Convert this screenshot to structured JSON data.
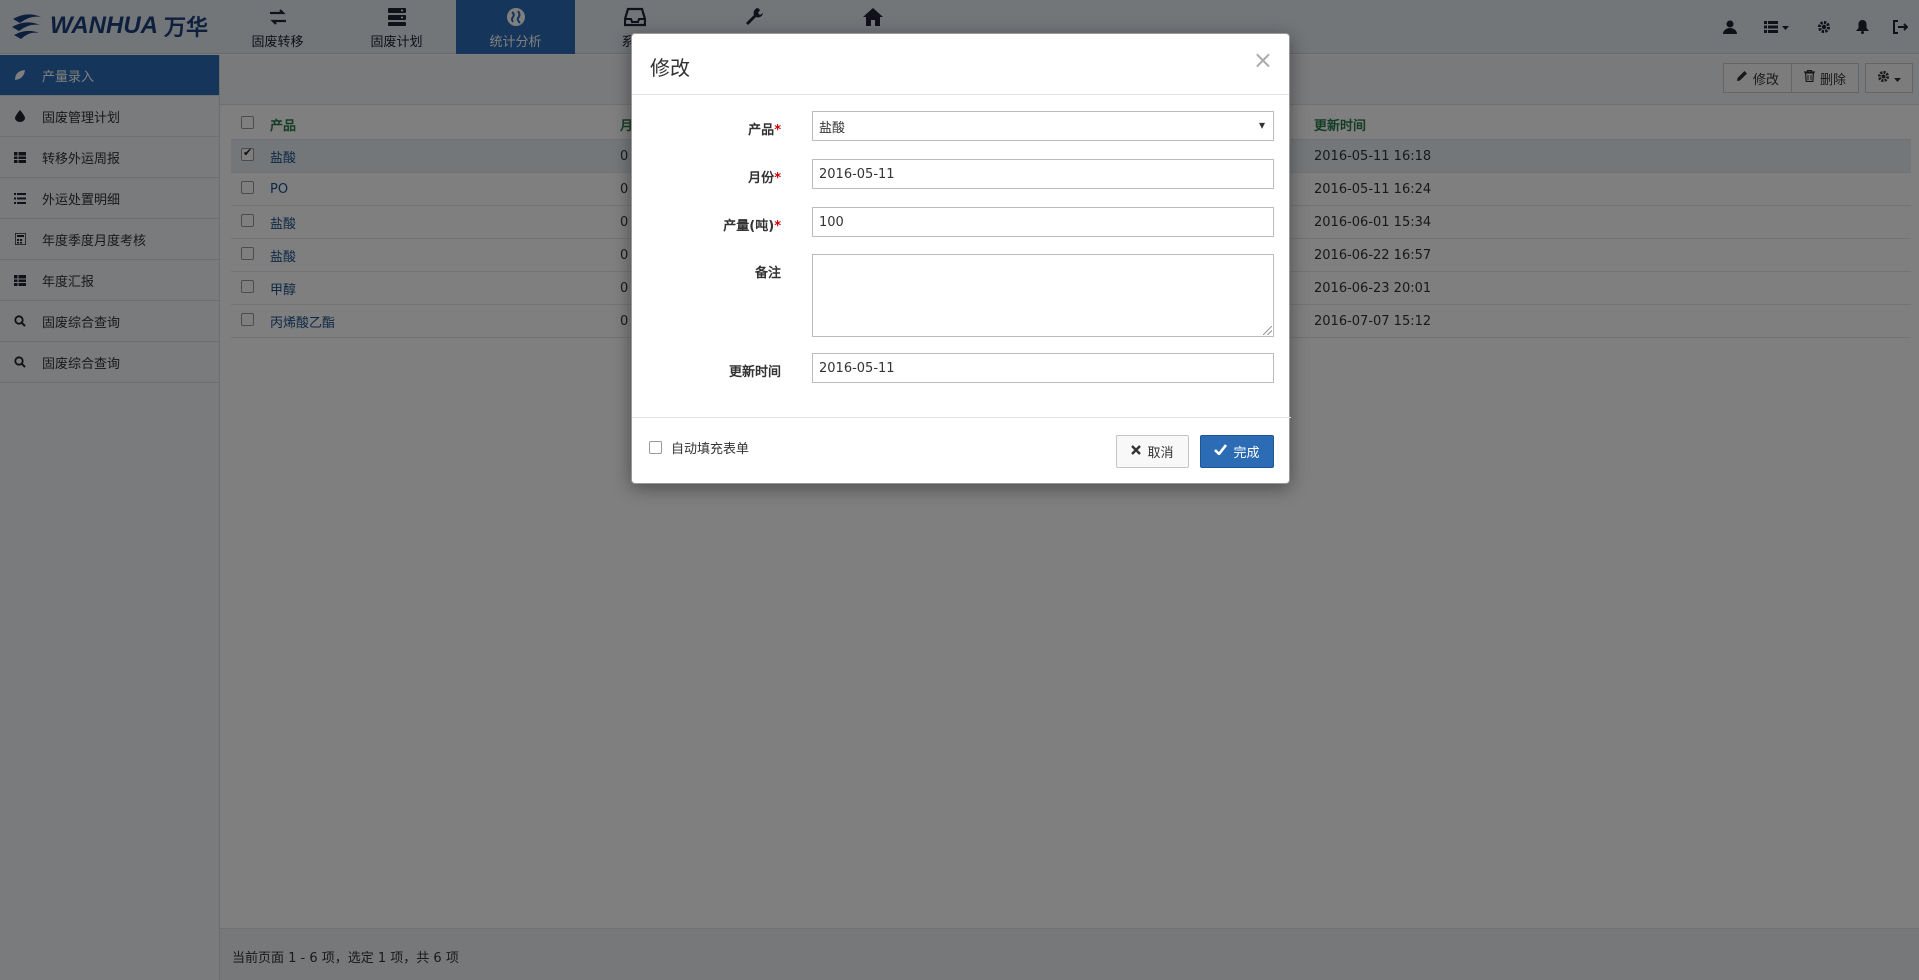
{
  "brand": {
    "name": "WANHUA",
    "name_cn": "万华"
  },
  "nav": {
    "tabs": [
      {
        "label": "固废转移",
        "icon": "swap-arrows-icon"
      },
      {
        "label": "固废计划",
        "icon": "server-stack-icon"
      },
      {
        "label": "统计分析",
        "icon": "globe-icon",
        "active": true
      },
      {
        "label": "系统",
        "icon": "inbox-tray-icon"
      },
      {
        "label": "",
        "icon": "wrench-icon"
      },
      {
        "label": "",
        "icon": "home-icon"
      }
    ],
    "right_icons": [
      "user-icon",
      "list-menu-icon",
      "gear-icon",
      "bell-icon",
      "logout-icon"
    ]
  },
  "sidebar": {
    "items": [
      {
        "label": "产量录入",
        "icon": "leaf-icon",
        "active": true
      },
      {
        "label": "固废管理计划",
        "icon": "drop-icon"
      },
      {
        "label": "转移外运周报",
        "icon": "table-icon"
      },
      {
        "label": "外运处置明细",
        "icon": "list-icon"
      },
      {
        "label": "年度季度月度考核",
        "icon": "calculator-icon"
      },
      {
        "label": "年度汇报",
        "icon": "table-icon"
      },
      {
        "label": "固废综合查询",
        "icon": "search-icon"
      },
      {
        "label": "固废综合查询",
        "icon": "search-icon"
      }
    ]
  },
  "toolbar": {
    "edit_label": "修改",
    "delete_label": "删除"
  },
  "grid": {
    "headers": {
      "product": "产品",
      "month": "月",
      "update_time": "更新时间"
    },
    "rows": [
      {
        "product": "盐酸",
        "month": "0",
        "update_time": "2016-05-11 16:18",
        "checked": true
      },
      {
        "product": "PO",
        "month": "0",
        "update_time": "2016-05-11 16:24",
        "checked": false
      },
      {
        "product": "盐酸",
        "month": "0",
        "update_time": "2016-06-01 15:34",
        "checked": false
      },
      {
        "product": "盐酸",
        "month": "0",
        "update_time": "2016-06-22 16:57",
        "checked": false
      },
      {
        "product": "甲醇",
        "month": "0",
        "update_time": "2016-06-23 20:01",
        "checked": false
      },
      {
        "product": "丙烯酸乙酯",
        "month": "0",
        "update_time": "2016-07-07 15:12",
        "checked": false
      }
    ]
  },
  "footer": {
    "status": "当前页面 1 - 6 项，选定 1 项，共 6 项"
  },
  "modal": {
    "title": "修改",
    "close": "×",
    "fields": {
      "product_label": "产品",
      "product_value": "盐酸",
      "month_label": "月份",
      "month_value": "2016-05-11",
      "output_label": "产量(吨)",
      "output_value": "100",
      "remark_label": "备注",
      "remark_value": "",
      "update_label": "更新时间",
      "update_value": "2016-05-11",
      "required_mark": "*"
    },
    "auto_fill_label": "自动填充表单",
    "cancel_label": "取消",
    "ok_label": "完成"
  },
  "colors": {
    "accent": "#2b6cb4",
    "header_green": "#2a7a4a",
    "required": "#cc0000"
  }
}
